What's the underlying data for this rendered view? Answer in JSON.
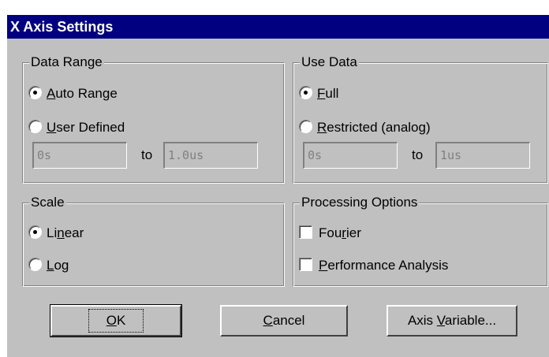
{
  "window": {
    "title": "X Axis Settings"
  },
  "data_range": {
    "legend": "Data Range",
    "options": [
      {
        "pre": "",
        "acc": "A",
        "post": "uto Range",
        "selected": true
      },
      {
        "pre": "",
        "acc": "U",
        "post": "ser Defined",
        "selected": false
      }
    ],
    "from_value": "0s",
    "to_label": "to",
    "to_value": "1.0us"
  },
  "use_data": {
    "legend": "Use Data",
    "options": [
      {
        "pre": "",
        "acc": "F",
        "post": "ull",
        "selected": true
      },
      {
        "pre": "",
        "acc": "R",
        "post": "estricted (analog)",
        "selected": false
      }
    ],
    "from_value": "0s",
    "to_label": "to",
    "to_value": "1us"
  },
  "scale": {
    "legend": "Scale",
    "options": [
      {
        "pre": "Li",
        "acc": "n",
        "post": "ear",
        "selected": true
      },
      {
        "pre": "",
        "acc": "L",
        "post": "og",
        "selected": false
      }
    ]
  },
  "processing": {
    "legend": "Processing Options",
    "options": [
      {
        "pre": "Fou",
        "acc": "r",
        "post": "ier",
        "checked": false
      },
      {
        "pre": "",
        "acc": "P",
        "post": "erformance Analysis",
        "checked": false
      }
    ]
  },
  "buttons": {
    "ok": {
      "pre": "",
      "acc": "O",
      "post": "K"
    },
    "cancel": {
      "pre": "",
      "acc": "C",
      "post": "ancel"
    },
    "axis_variable": {
      "pre": "Axis ",
      "acc": "V",
      "post": "ariable..."
    }
  }
}
